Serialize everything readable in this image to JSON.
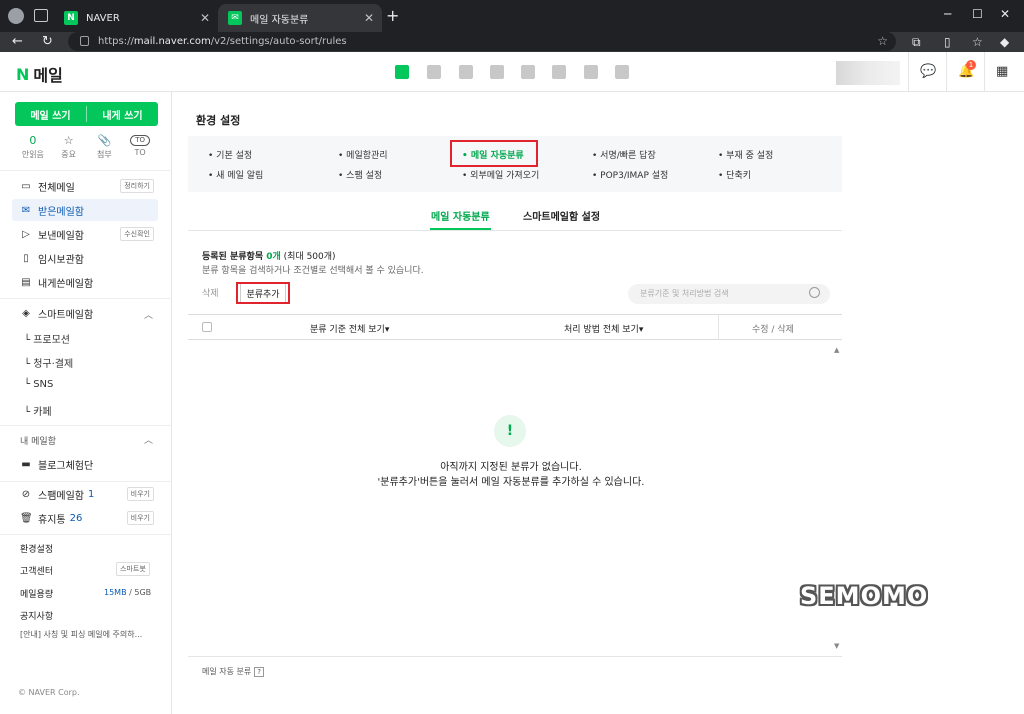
{
  "browser": {
    "tabs": [
      {
        "title": "NAVER",
        "favicon": "N",
        "active": false
      },
      {
        "title": "메일 자동분류",
        "favicon": "✉",
        "active": true
      }
    ],
    "url_prefix": "https://",
    "url_host": "mail.naver.com",
    "url_path": "/v2/settings/auto-sort/rules"
  },
  "header": {
    "logo_n": "N",
    "logo_text": "메일",
    "notification_count": "1",
    "services": [
      "mail-icon",
      "calendar-icon",
      "photo-icon",
      "contacts-icon",
      "box-icon",
      "memo-icon",
      "wallet-icon",
      "bookmark-icon"
    ]
  },
  "sidebar": {
    "compose_label": "메일 쓰기",
    "self_compose_label": "내게 쓰기",
    "quick": [
      {
        "value": "0",
        "label": "안읽음"
      },
      {
        "value": "☆",
        "label": "중요"
      },
      {
        "value": "📎",
        "label": "첨부"
      },
      {
        "value": "TO",
        "label": "TO"
      }
    ],
    "folders": [
      {
        "icon": "▭",
        "label": "전체메일",
        "action": "정리하기"
      },
      {
        "icon": "✉",
        "label": "받은메일함",
        "action": ""
      },
      {
        "icon": "▷",
        "label": "보낸메일함",
        "action": "수신확인"
      },
      {
        "icon": "▯",
        "label": "임시보관함",
        "action": ""
      },
      {
        "icon": "▤",
        "label": "내게쓴메일함",
        "action": ""
      }
    ],
    "smart_title": "스마트메일함",
    "smart_items": [
      "└ 프로모션",
      "└ 청구·결제",
      "└ SNS",
      "└ 카페"
    ],
    "my_title": "내 메일함",
    "my_folder": "블로그체험단",
    "spam": {
      "label": "스팸메일함",
      "count": "1",
      "action": "비우기"
    },
    "trash": {
      "label": "휴지통",
      "count": "26",
      "action": "비우기"
    },
    "settings_label": "환경설정",
    "support_label": "고객센터",
    "support_action": "스마트봇",
    "storage_label": "메일용량",
    "storage_used": "15MB",
    "storage_total": " / 5GB",
    "notice_label": "공지사항",
    "notice_text": "[안내] 사칭 및 피싱 메일에 주의하...",
    "copyright": "© NAVER Corp."
  },
  "main": {
    "title": "환경 설정",
    "settings_links": [
      "• 기본 설정",
      "• 메일함관리",
      "• 메일 자동분류",
      "• 서명/빠른 답장",
      "• 부재 중 설정",
      "• 새 메일 알림",
      "• 스팸 설정",
      "• 외부메일 가져오기",
      "• POP3/IMAP 설정",
      "• 단축키"
    ],
    "subtabs": [
      "메일 자동분류",
      "스마트메일함 설정"
    ],
    "registered_prefix": "등록된 분류항목 ",
    "registered_count": "0개",
    "registered_suffix": " (최대 500개)",
    "registered_desc": "분류 항목을 검색하거나 조건별로 선택해서 볼 수 있습니다.",
    "delete_label": "삭제",
    "add_label": "분류추가",
    "search_placeholder": "분류기준 및 처리방법 검색",
    "columns": [
      "분류 기준 전체 보기▾",
      "처리 방법 전체 보기▾",
      "수정 / 삭제"
    ],
    "empty_line1": "아직까지 지정된 분류가 없습니다.",
    "empty_line2": "'분류추가'버튼을 눌러서 메일 자동분류를 추가하실 수 있습니다.",
    "footer_label": "메일 자동 분류",
    "footer_help": "?",
    "watermark": "SEMOMO"
  }
}
